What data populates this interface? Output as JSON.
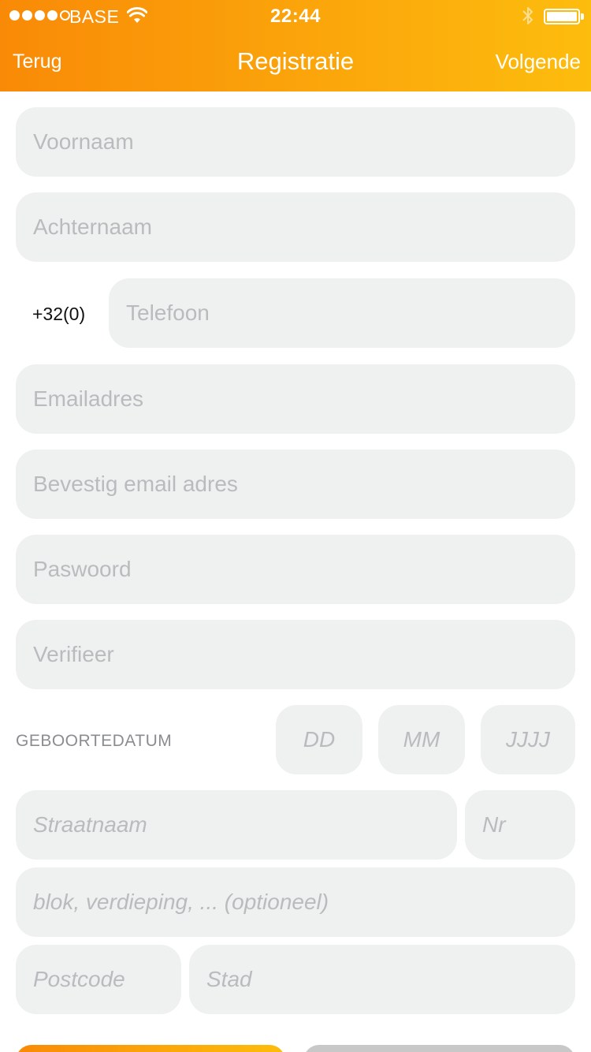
{
  "status_bar": {
    "carrier": "BASE",
    "time": "22:44",
    "signal_icon": "signal-dots-icon",
    "wifi_icon": "wifi-icon",
    "bluetooth_icon": "bluetooth-icon",
    "battery_icon": "battery-icon"
  },
  "nav": {
    "back_label": "Terug",
    "title": "Registratie",
    "next_label": "Volgende"
  },
  "form": {
    "first_name_placeholder": "Voornaam",
    "last_name_placeholder": "Achternaam",
    "phone_prefix": "+32(0)",
    "phone_placeholder": "Telefoon",
    "email_placeholder": "Emailadres",
    "email_confirm_placeholder": "Bevestig email adres",
    "password_placeholder": "Paswoord",
    "verify_placeholder": "Verifieer",
    "birthdate_label": "GEBOORTEDATUM",
    "day_placeholder": "DD",
    "month_placeholder": "MM",
    "year_placeholder": "JJJJ",
    "street_placeholder": "Straatnaam",
    "number_placeholder": "Nr",
    "extra_placeholder": "blok, verdieping, ... (optioneel)",
    "postcode_placeholder": "Postcode",
    "city_placeholder": "Stad"
  },
  "colors": {
    "accent_start": "#f98a07",
    "accent_end": "#fdbd0d",
    "field_bg": "#eff0f0",
    "placeholder": "#b9bcbe"
  }
}
